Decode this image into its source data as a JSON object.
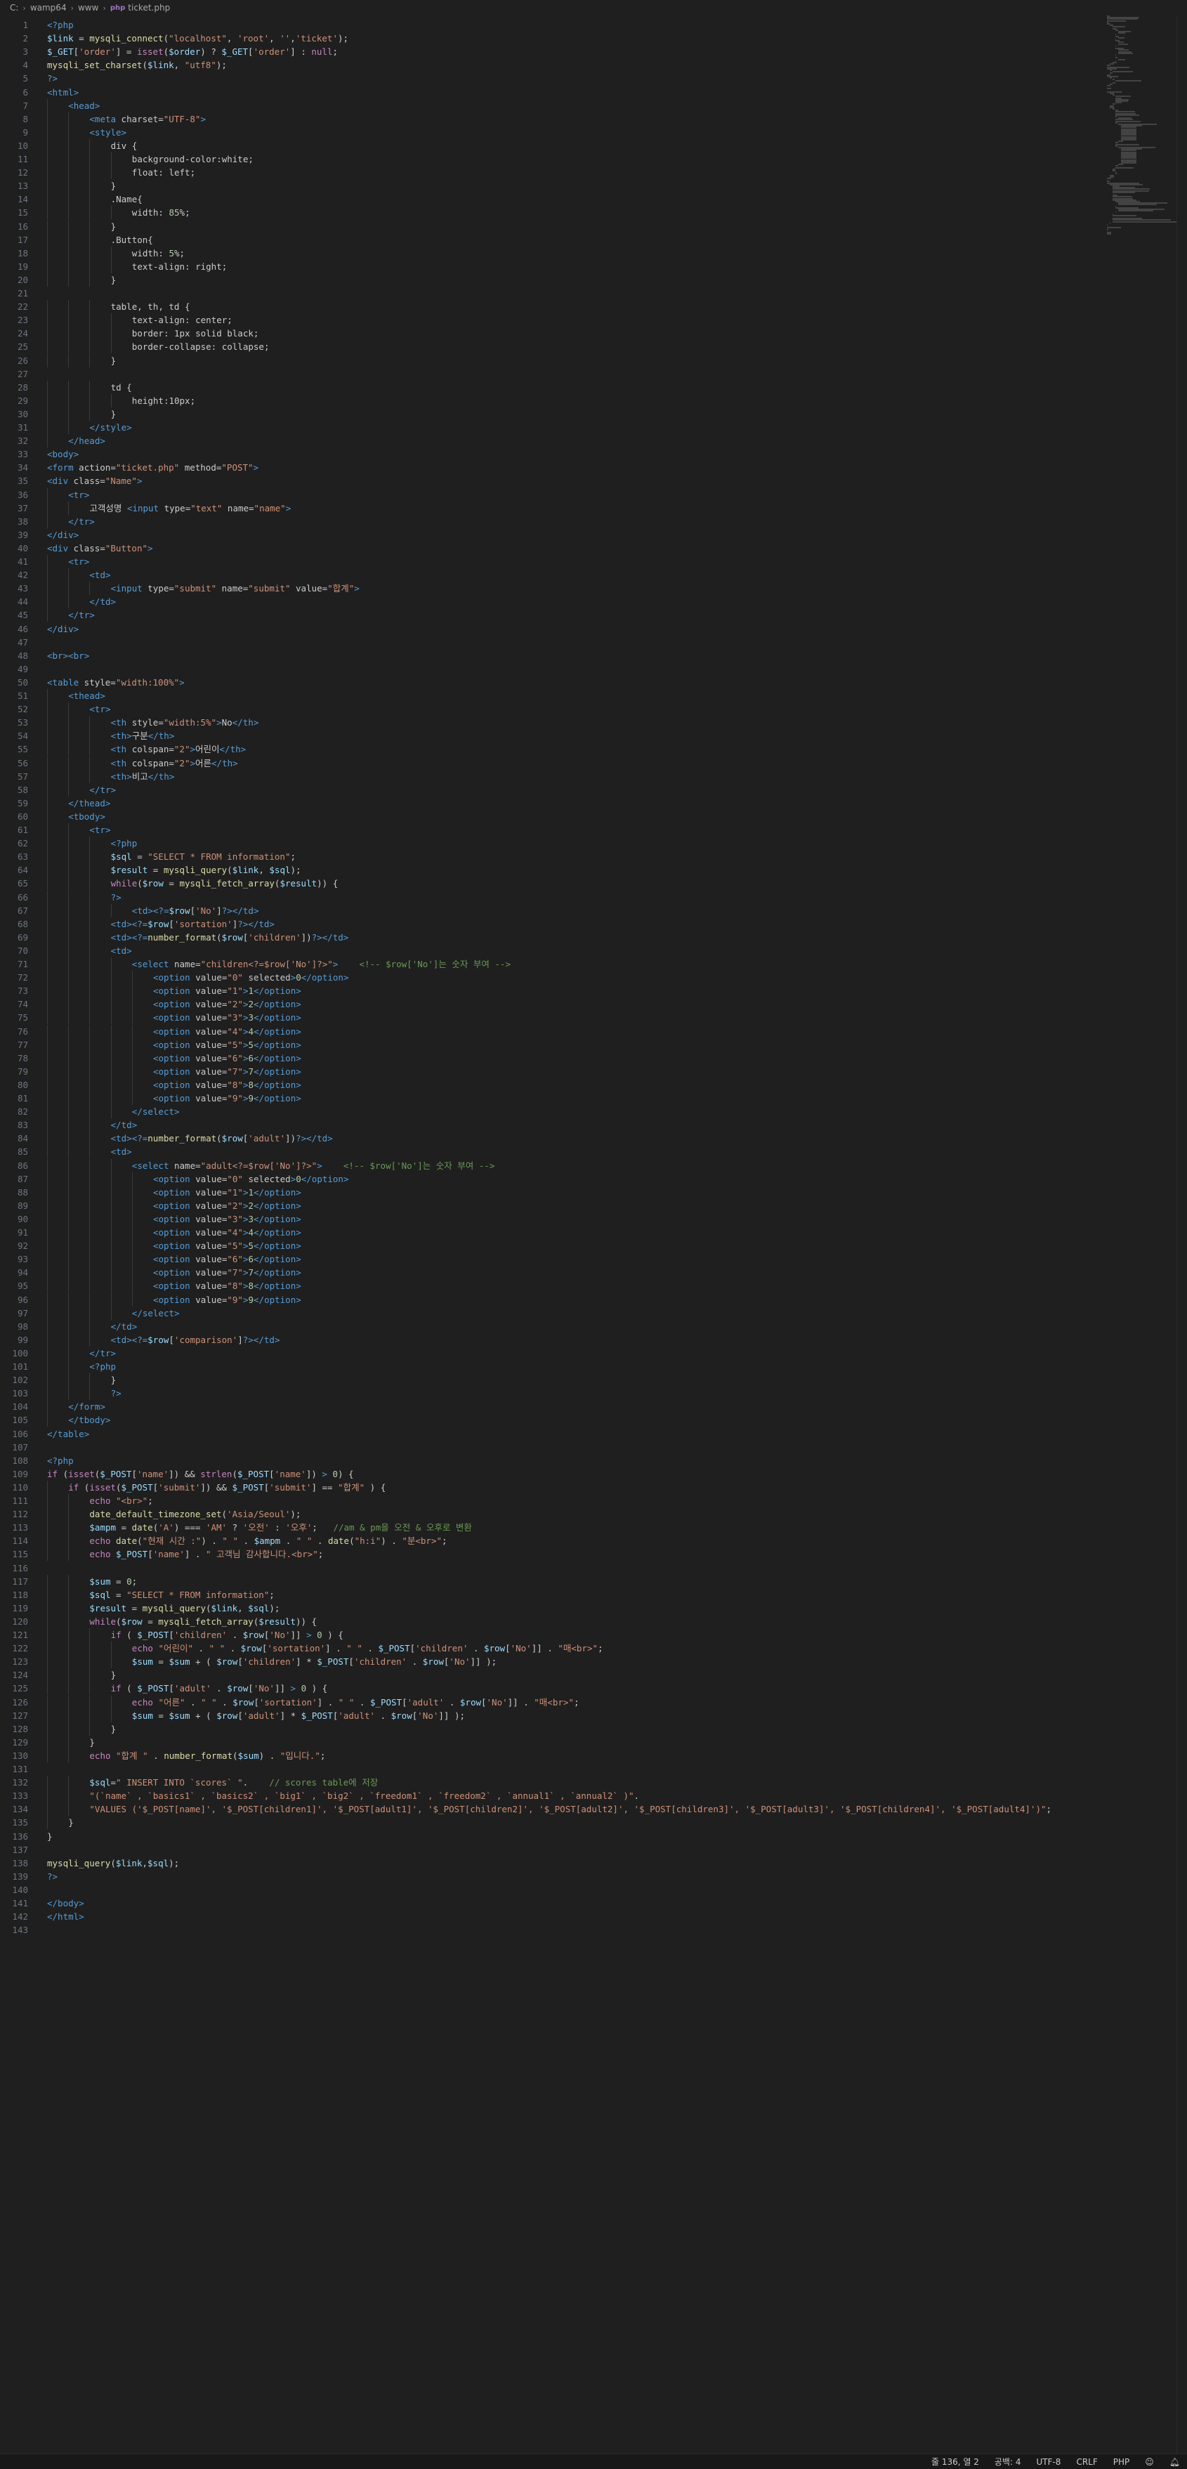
{
  "breadcrumb": {
    "items": [
      "C:",
      "wamp64",
      "www"
    ],
    "file_icon": "php-file-icon",
    "file_name": "ticket.php"
  },
  "statusbar": {
    "position": "줄 136, 열 2",
    "spaces": "공백: 4",
    "encoding": "UTF-8",
    "eol": "CRLF",
    "language": "PHP",
    "icons": [
      "feedback-icon",
      "bell-icon"
    ]
  },
  "editor": {
    "total_lines": 143
  },
  "code_lines": [
    {
      "n": "1",
      "i": 0,
      "t": "<?php"
    },
    {
      "n": "2",
      "i": 0,
      "t": "$link = mysqli_connect(\"localhost\", 'root', '','ticket');"
    },
    {
      "n": "3",
      "i": 0,
      "t": "$_GET['order'] = isset($order) ? $_GET['order'] : null;"
    },
    {
      "n": "4",
      "i": 0,
      "t": "mysqli_set_charset($link, \"utf8\");"
    },
    {
      "n": "5",
      "i": 0,
      "t": "?>"
    },
    {
      "n": "6",
      "i": 0,
      "t": "<html>"
    },
    {
      "n": "7",
      "i": 1,
      "t": "<head>"
    },
    {
      "n": "8",
      "i": 2,
      "t": "<meta charset=\"UTF-8\">"
    },
    {
      "n": "9",
      "i": 2,
      "t": "<style>"
    },
    {
      "n": "10",
      "i": 3,
      "t": "div {"
    },
    {
      "n": "11",
      "i": 4,
      "t": "background-color:white;"
    },
    {
      "n": "12",
      "i": 4,
      "t": "float: left;"
    },
    {
      "n": "13",
      "i": 3,
      "t": "}"
    },
    {
      "n": "14",
      "i": 3,
      "t": ".Name{"
    },
    {
      "n": "15",
      "i": 4,
      "t": "width: 85%;"
    },
    {
      "n": "16",
      "i": 3,
      "t": "}"
    },
    {
      "n": "17",
      "i": 3,
      "t": ".Button{"
    },
    {
      "n": "18",
      "i": 4,
      "t": "width: 5%;"
    },
    {
      "n": "19",
      "i": 4,
      "t": "text-align: right;"
    },
    {
      "n": "20",
      "i": 3,
      "t": "}"
    },
    {
      "n": "21",
      "i": 0,
      "t": ""
    },
    {
      "n": "22",
      "i": 3,
      "t": "table, th, td {"
    },
    {
      "n": "23",
      "i": 4,
      "t": "text-align: center;"
    },
    {
      "n": "24",
      "i": 4,
      "t": "border: 1px solid black;"
    },
    {
      "n": "25",
      "i": 4,
      "t": "border-collapse: collapse;"
    },
    {
      "n": "26",
      "i": 3,
      "t": "}"
    },
    {
      "n": "27",
      "i": 0,
      "t": ""
    },
    {
      "n": "28",
      "i": 3,
      "t": "td {"
    },
    {
      "n": "29",
      "i": 4,
      "t": "height:10px;"
    },
    {
      "n": "30",
      "i": 3,
      "t": "}"
    },
    {
      "n": "31",
      "i": 2,
      "t": "</style>"
    },
    {
      "n": "32",
      "i": 1,
      "t": "</head>"
    },
    {
      "n": "33",
      "i": 0,
      "t": "<body>"
    },
    {
      "n": "34",
      "i": 0,
      "t": "<form action=\"ticket.php\" method=\"POST\">"
    },
    {
      "n": "35",
      "i": 0,
      "t": "<div class=\"Name\">"
    },
    {
      "n": "36",
      "i": 1,
      "t": "<tr>"
    },
    {
      "n": "37",
      "i": 2,
      "t": "고객성명 <input type=\"text\" name=\"name\">"
    },
    {
      "n": "38",
      "i": 1,
      "t": "</tr>"
    },
    {
      "n": "39",
      "i": 0,
      "t": "</div>"
    },
    {
      "n": "40",
      "i": 0,
      "t": "<div class=\"Button\">"
    },
    {
      "n": "41",
      "i": 1,
      "t": "<tr>"
    },
    {
      "n": "42",
      "i": 2,
      "t": "<td>"
    },
    {
      "n": "43",
      "i": 3,
      "t": "<input type=\"submit\" name=\"submit\" value=\"합계\">"
    },
    {
      "n": "44",
      "i": 2,
      "t": "</td>"
    },
    {
      "n": "45",
      "i": 1,
      "t": "</tr>"
    },
    {
      "n": "46",
      "i": 0,
      "t": "</div>"
    },
    {
      "n": "47",
      "i": 0,
      "t": ""
    },
    {
      "n": "48",
      "i": 0,
      "t": "<br><br>"
    },
    {
      "n": "49",
      "i": 0,
      "t": ""
    },
    {
      "n": "50",
      "i": 0,
      "t": "<table style=\"width:100%\">"
    },
    {
      "n": "51",
      "i": 1,
      "t": "<thead>"
    },
    {
      "n": "52",
      "i": 2,
      "t": "<tr>"
    },
    {
      "n": "53",
      "i": 3,
      "t": "<th style=\"width:5%\">No</th>"
    },
    {
      "n": "54",
      "i": 3,
      "t": "<th>구분</th>"
    },
    {
      "n": "55",
      "i": 3,
      "t": "<th colspan=\"2\">어린이</th>"
    },
    {
      "n": "56",
      "i": 3,
      "t": "<th colspan=\"2\">어른</th>"
    },
    {
      "n": "57",
      "i": 3,
      "t": "<th>비고</th>"
    },
    {
      "n": "58",
      "i": 2,
      "t": "</tr>"
    },
    {
      "n": "59",
      "i": 1,
      "t": "</thead>"
    },
    {
      "n": "60",
      "i": 1,
      "t": "<tbody>"
    },
    {
      "n": "61",
      "i": 2,
      "t": "<tr>"
    },
    {
      "n": "62",
      "i": 3,
      "t": "<?php"
    },
    {
      "n": "63",
      "i": 3,
      "t": "$sql = \"SELECT * FROM information\";"
    },
    {
      "n": "64",
      "i": 3,
      "t": "$result = mysqli_query($link, $sql);"
    },
    {
      "n": "65",
      "i": 3,
      "t": "while($row = mysqli_fetch_array($result)) {"
    },
    {
      "n": "66",
      "i": 3,
      "t": "?>"
    },
    {
      "n": "67",
      "i": 4,
      "t": "<td><?=$row['No']?></td>"
    },
    {
      "n": "68",
      "i": 3,
      "t": "<td><?=$row['sortation']?></td>"
    },
    {
      "n": "69",
      "i": 3,
      "t": "<td><?=number_format($row['children'])?></td>"
    },
    {
      "n": "70",
      "i": 3,
      "t": "<td>"
    },
    {
      "n": "71",
      "i": 4,
      "t": "<select name=\"children<?=$row['No']?>\">    <!-- $row['No']는 숫자 부여 -->"
    },
    {
      "n": "72",
      "i": 5,
      "t": "<option value=\"0\" selected>0</option>"
    },
    {
      "n": "73",
      "i": 5,
      "t": "<option value=\"1\">1</option>"
    },
    {
      "n": "74",
      "i": 5,
      "t": "<option value=\"2\">2</option>"
    },
    {
      "n": "75",
      "i": 5,
      "t": "<option value=\"3\">3</option>"
    },
    {
      "n": "76",
      "i": 5,
      "t": "<option value=\"4\">4</option>"
    },
    {
      "n": "77",
      "i": 5,
      "t": "<option value=\"5\">5</option>"
    },
    {
      "n": "78",
      "i": 5,
      "t": "<option value=\"6\">6</option>"
    },
    {
      "n": "79",
      "i": 5,
      "t": "<option value=\"7\">7</option>"
    },
    {
      "n": "80",
      "i": 5,
      "t": "<option value=\"8\">8</option>"
    },
    {
      "n": "81",
      "i": 5,
      "t": "<option value=\"9\">9</option>"
    },
    {
      "n": "82",
      "i": 4,
      "t": "</select>"
    },
    {
      "n": "83",
      "i": 3,
      "t": "</td>"
    },
    {
      "n": "84",
      "i": 3,
      "t": "<td><?=number_format($row['adult'])?></td>"
    },
    {
      "n": "85",
      "i": 3,
      "t": "<td>"
    },
    {
      "n": "86",
      "i": 4,
      "t": "<select name=\"adult<?=$row['No']?>\">    <!-- $row['No']는 숫자 부여 -->"
    },
    {
      "n": "87",
      "i": 5,
      "t": "<option value=\"0\" selected>0</option>"
    },
    {
      "n": "88",
      "i": 5,
      "t": "<option value=\"1\">1</option>"
    },
    {
      "n": "89",
      "i": 5,
      "t": "<option value=\"2\">2</option>"
    },
    {
      "n": "90",
      "i": 5,
      "t": "<option value=\"3\">3</option>"
    },
    {
      "n": "91",
      "i": 5,
      "t": "<option value=\"4\">4</option>"
    },
    {
      "n": "92",
      "i": 5,
      "t": "<option value=\"5\">5</option>"
    },
    {
      "n": "93",
      "i": 5,
      "t": "<option value=\"6\">6</option>"
    },
    {
      "n": "94",
      "i": 5,
      "t": "<option value=\"7\">7</option>"
    },
    {
      "n": "95",
      "i": 5,
      "t": "<option value=\"8\">8</option>"
    },
    {
      "n": "96",
      "i": 5,
      "t": "<option value=\"9\">9</option>"
    },
    {
      "n": "97",
      "i": 4,
      "t": "</select>"
    },
    {
      "n": "98",
      "i": 3,
      "t": "</td>"
    },
    {
      "n": "99",
      "i": 3,
      "t": "<td><?=$row['comparison']?></td>"
    },
    {
      "n": "100",
      "i": 2,
      "t": "</tr>"
    },
    {
      "n": "101",
      "i": 2,
      "t": "<?php"
    },
    {
      "n": "102",
      "i": 3,
      "t": "}"
    },
    {
      "n": "103",
      "i": 3,
      "t": "?>"
    },
    {
      "n": "104",
      "i": 1,
      "t": "</form>"
    },
    {
      "n": "105",
      "i": 1,
      "t": "</tbody>"
    },
    {
      "n": "106",
      "i": 0,
      "t": "</table>"
    },
    {
      "n": "107",
      "i": 0,
      "t": ""
    },
    {
      "n": "108",
      "i": 0,
      "t": "<?php"
    },
    {
      "n": "109",
      "i": 0,
      "t": "if (isset($_POST['name']) && strlen($_POST['name']) > 0) {"
    },
    {
      "n": "110",
      "i": 1,
      "t": "if (isset($_POST['submit']) && $_POST['submit'] == \"합계\" ) {"
    },
    {
      "n": "111",
      "i": 2,
      "t": "echo \"<br>\";"
    },
    {
      "n": "112",
      "i": 2,
      "t": "date_default_timezone_set('Asia/Seoul');"
    },
    {
      "n": "113",
      "i": 2,
      "t": "$ampm = date('A') === 'AM' ? '오전' : '오후';   //am & pm을 오전 & 오후로 변환"
    },
    {
      "n": "114",
      "i": 2,
      "t": "echo date(\"현재 시간 :\") . \" \" . $ampm . \" \" . date(\"h:i\") . \"분<br>\";"
    },
    {
      "n": "115",
      "i": 2,
      "t": "echo $_POST['name'] . \" 고객님 감사합니다.<br>\";"
    },
    {
      "n": "116",
      "i": 0,
      "t": ""
    },
    {
      "n": "117",
      "i": 2,
      "t": "$sum = 0;"
    },
    {
      "n": "118",
      "i": 2,
      "t": "$sql = \"SELECT * FROM information\";"
    },
    {
      "n": "119",
      "i": 2,
      "t": "$result = mysqli_query($link, $sql);"
    },
    {
      "n": "120",
      "i": 2,
      "t": "while($row = mysqli_fetch_array($result)) {"
    },
    {
      "n": "121",
      "i": 3,
      "t": "if ( $_POST['children' . $row['No']] > 0 ) {"
    },
    {
      "n": "122",
      "i": 4,
      "t": "echo \"어린이\" . \" \" . $row['sortation'] . \" \" . $_POST['children' . $row['No']] . \"매<br>\";"
    },
    {
      "n": "123",
      "i": 4,
      "t": "$sum = $sum + ( $row['children'] * $_POST['children' . $row['No']] );"
    },
    {
      "n": "124",
      "i": 3,
      "t": "}"
    },
    {
      "n": "125",
      "i": 3,
      "t": "if ( $_POST['adult' . $row['No']] > 0 ) {"
    },
    {
      "n": "126",
      "i": 4,
      "t": "echo \"어른\" . \" \" . $row['sortation'] . \" \" . $_POST['adult' . $row['No']] . \"매<br>\";"
    },
    {
      "n": "127",
      "i": 4,
      "t": "$sum = $sum + ( $row['adult'] * $_POST['adult' . $row['No']] );"
    },
    {
      "n": "128",
      "i": 3,
      "t": "}"
    },
    {
      "n": "129",
      "i": 2,
      "t": "}"
    },
    {
      "n": "130",
      "i": 2,
      "t": "echo \"합계 \" . number_format($sum) . \"입니다.\";"
    },
    {
      "n": "131",
      "i": 0,
      "t": ""
    },
    {
      "n": "132",
      "i": 2,
      "t": "$sql=\" INSERT INTO `scores` \".    // scores table에 저장"
    },
    {
      "n": "133",
      "i": 2,
      "t": "\"(`name` , `basics1` , `basics2` , `big1` , `big2` , `freedom1` , `freedom2` , `annual1` , `annual2` )\"."
    },
    {
      "n": "134",
      "i": 2,
      "t": "\"VALUES ('$_POST[name]', '$_POST[children1]', '$_POST[adult1]', '$_POST[children2]', '$_POST[adult2]', '$_POST[children3]', '$_POST[adult3]', '$_POST[children4]', '$_POST[adult4]')\";"
    },
    {
      "n": "135",
      "i": 1,
      "t": "}"
    },
    {
      "n": "136",
      "i": 0,
      "t": "}"
    },
    {
      "n": "137",
      "i": 0,
      "t": ""
    },
    {
      "n": "138",
      "i": 0,
      "t": "mysqli_query($link,$sql);"
    },
    {
      "n": "139",
      "i": 0,
      "t": "?>"
    },
    {
      "n": "140",
      "i": 0,
      "t": ""
    },
    {
      "n": "141",
      "i": 0,
      "t": "</body>"
    },
    {
      "n": "142",
      "i": 0,
      "t": "</html>"
    },
    {
      "n": "143",
      "i": 0,
      "t": ""
    }
  ],
  "colors": {
    "background": "#1f1f1f",
    "line_number": "#6e7681",
    "tag": "#569cd6",
    "attribute": "#9cdcfe",
    "string": "#ce9178",
    "function": "#dcdcaa",
    "comment": "#6a9955"
  }
}
